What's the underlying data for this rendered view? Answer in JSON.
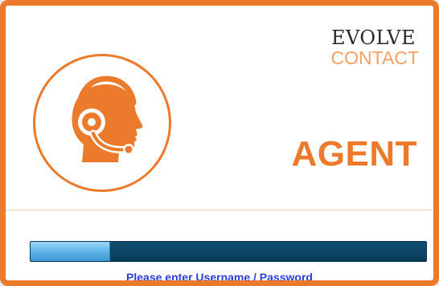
{
  "brand": {
    "line1": "EVOLVE",
    "line2": "CONTACT"
  },
  "title": "AGENT",
  "logo_icon": "headset-agent-icon",
  "progress": {
    "fraction": 0.2
  },
  "status": "Please enter Username / Password",
  "colors": {
    "accent": "#ec7a2d",
    "brand_light": "#f3a164",
    "progress_track": "#0d4666",
    "progress_fill": "#64b8e8",
    "status_text": "#2b3fd6"
  }
}
